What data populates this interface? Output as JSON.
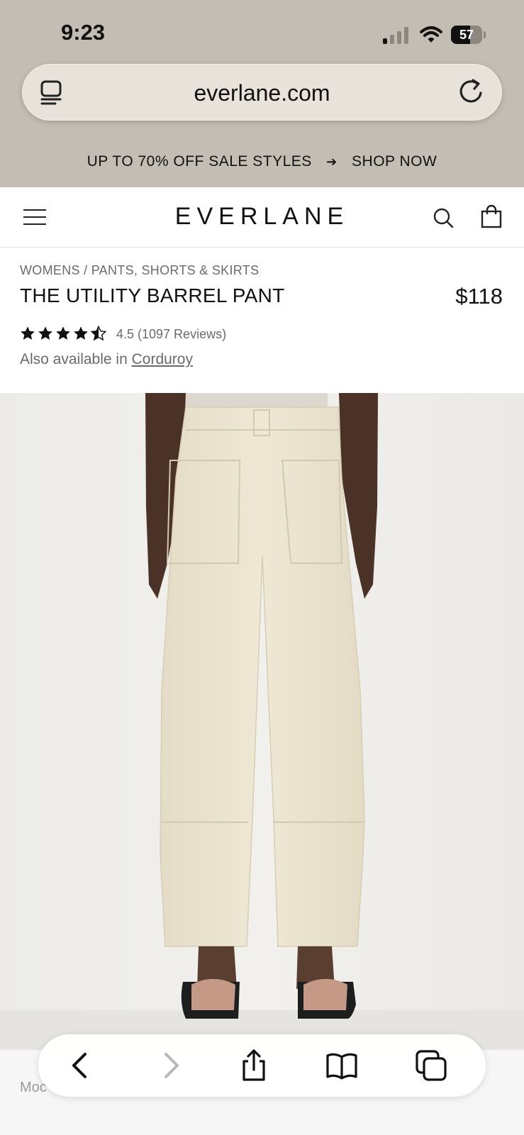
{
  "status_bar": {
    "time": "9:23",
    "battery": "57"
  },
  "browser": {
    "url": "everlane.com"
  },
  "promo": {
    "text": "UP TO 70% OFF SALE STYLES",
    "arrow": "➔",
    "cta": "SHOP NOW"
  },
  "header": {
    "logo": "EVERLANE"
  },
  "product": {
    "breadcrumb": "WOMENS / PANTS, SHORTS & SKIRTS",
    "title": "THE UTILITY BARREL PANT",
    "price": "$118",
    "rating_text": "4.5 (1097 Reviews)",
    "rating_value": 4.5,
    "also_available_label": "Also available in",
    "also_available_link": "Corduroy"
  },
  "below_photo": {
    "model_text": "Moc"
  },
  "toolbar_icons": [
    "back-icon",
    "forward-icon",
    "share-icon",
    "bookmarks-icon",
    "tabs-icon"
  ],
  "colors": {
    "top_background": "#c4bdb4",
    "url_bar": "#e8e2db",
    "pant": "#ede6d2",
    "skin": "#4a3326"
  }
}
